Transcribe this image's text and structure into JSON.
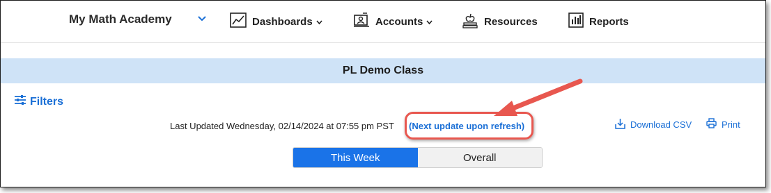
{
  "header": {
    "brand": "My Math Academy",
    "nav": [
      {
        "label": "Dashboards",
        "icon": "chart-icon",
        "has_menu": true
      },
      {
        "label": "Accounts",
        "icon": "accounts-icon",
        "has_menu": true
      },
      {
        "label": "Resources",
        "icon": "resources-icon",
        "has_menu": false
      },
      {
        "label": "Reports",
        "icon": "reports-icon",
        "has_menu": false
      }
    ]
  },
  "class_banner": {
    "title": "PL Demo Class"
  },
  "filters": {
    "label": "Filters",
    "icon": "sliders-icon"
  },
  "status": {
    "last_updated": "Last Updated Wednesday, 02/14/2024 at 07:55 pm PST",
    "next_update": "(Next update upon refresh)"
  },
  "tools": {
    "download_label": "Download CSV",
    "print_label": "Print"
  },
  "view_toggle": {
    "options": [
      "This Week",
      "Overall"
    ],
    "selected": "This Week"
  },
  "colors": {
    "accent": "#1a73e8",
    "link": "#1a6fd6",
    "banner": "#cfe3f7",
    "annotation": "#e8574f"
  }
}
